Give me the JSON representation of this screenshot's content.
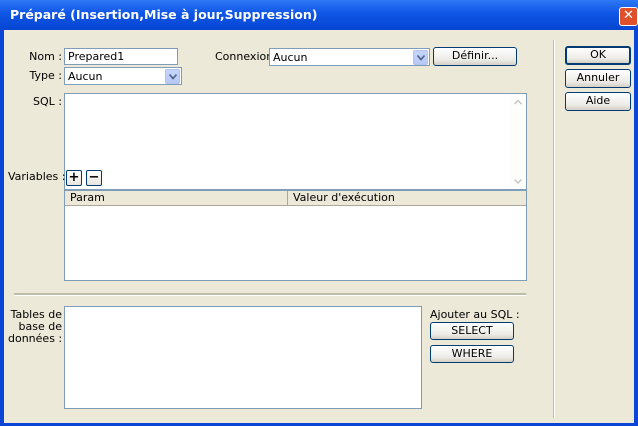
{
  "window": {
    "title": "Préparé (Insertion,Mise à jour,Suppression)",
    "close_symbol": "✕"
  },
  "form": {
    "nom_label": "Nom :",
    "nom_value": "Prepared1",
    "type_label": "Type :",
    "type_value": "Aucun",
    "connexion_label": "Connexion :",
    "connexion_value": "Aucun",
    "definir_label": "Définir...",
    "sql_label": "SQL :",
    "sql_value": ""
  },
  "variables": {
    "label": "Variables :",
    "add_symbol": "+",
    "remove_symbol": "−",
    "columns": [
      "Param",
      "Valeur d'exécution"
    ],
    "rows": []
  },
  "database": {
    "tables_label_line1": "Tables de",
    "tables_label_line2": "base de",
    "tables_label_line3": "données :",
    "add_to_sql_label": "Ajouter au SQL :",
    "select_label": "SELECT",
    "where_label": "WHERE"
  },
  "side_buttons": {
    "ok_label": "OK",
    "cancel_label": "Annuler",
    "help_label": "Aide"
  },
  "colors": {
    "titlebar": "#0a45d6",
    "dialog_bg": "#ece9d8",
    "field_border": "#7f9db9"
  }
}
